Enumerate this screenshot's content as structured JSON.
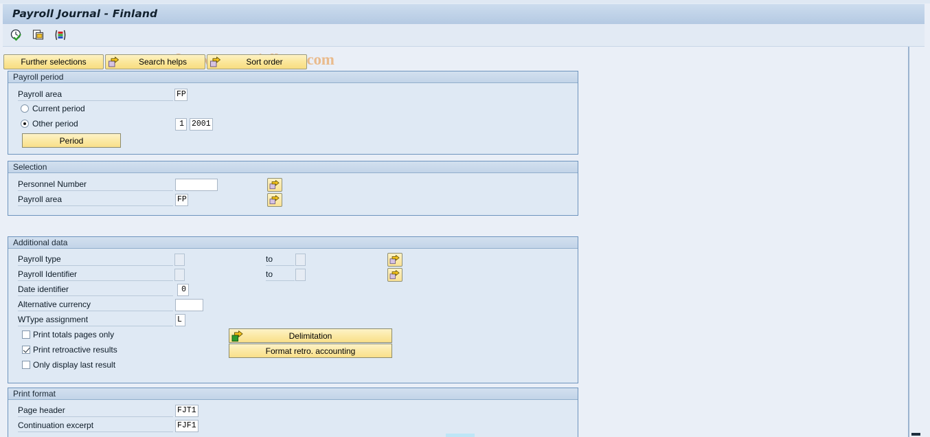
{
  "window": {
    "title": "Payroll Journal - Finland",
    "watermark": "© www.tutorialkart.com"
  },
  "toolbar": {
    "icons": [
      {
        "name": "execute-clock-icon",
        "title": "Execute"
      },
      {
        "name": "multiple-selection-copy-icon",
        "title": "Get Variant"
      },
      {
        "name": "colored-bars-icon",
        "title": "Display Variant"
      }
    ]
  },
  "button_bar": [
    {
      "label": "Further selections",
      "icon": null
    },
    {
      "label": "Search helps",
      "icon": "arrow-right-icon"
    },
    {
      "label": "Sort order",
      "icon": "arrow-right-icon"
    }
  ],
  "payroll_period": {
    "header": "Payroll period",
    "payroll_area_label": "Payroll area",
    "payroll_area_value": "FP",
    "current_period_label": "Current period",
    "current_period_selected": false,
    "other_period_label": "Other period",
    "other_period_selected": true,
    "other_period_number": "1",
    "other_period_year": "2001",
    "period_button": "Period"
  },
  "selection": {
    "header": "Selection",
    "rows": [
      {
        "label": "Personnel Number",
        "value": "",
        "multi_select": true
      },
      {
        "label": "Payroll area",
        "value": "FP",
        "multi_select": true
      }
    ]
  },
  "additional_data": {
    "header": "Additional data",
    "to_label": "to",
    "range_rows": [
      {
        "label": "Payroll type",
        "from": "",
        "to": "",
        "multi_select": true
      },
      {
        "label": "Payroll Identifier",
        "from": "",
        "to": "",
        "multi_select": true
      }
    ],
    "single_rows": [
      {
        "label": "Date identifier",
        "value": "0"
      },
      {
        "label": "Alternative currency",
        "value": ""
      },
      {
        "label": "WType assignment",
        "value": "L"
      }
    ],
    "checkboxes": [
      {
        "label": "Print totals pages only",
        "checked": false
      },
      {
        "label": "Print retroactive results",
        "checked": true
      },
      {
        "label": "Only display last result",
        "checked": false
      }
    ],
    "buttons": [
      {
        "label": "Delimitation",
        "icon": "arrow-right-green-icon"
      },
      {
        "label": "Format retro. accounting",
        "icon": null
      }
    ]
  },
  "print_format": {
    "header": "Print format",
    "rows": [
      {
        "label": "Page header",
        "value": "FJT1"
      },
      {
        "label": "Continuation excerpt",
        "value": "FJF1"
      }
    ]
  },
  "scrollbar": {
    "up_arrow": "scroll-up-icon",
    "down_arrow": "scroll-down-icon"
  },
  "colors": {
    "title_bar": "#bfd2e8",
    "button_yellow": "#fbe79b",
    "group_bg": "#dfe9f4",
    "group_border": "#6d93bd",
    "watermark": "#e9bb8d",
    "page_bg": "#eaeff7"
  }
}
